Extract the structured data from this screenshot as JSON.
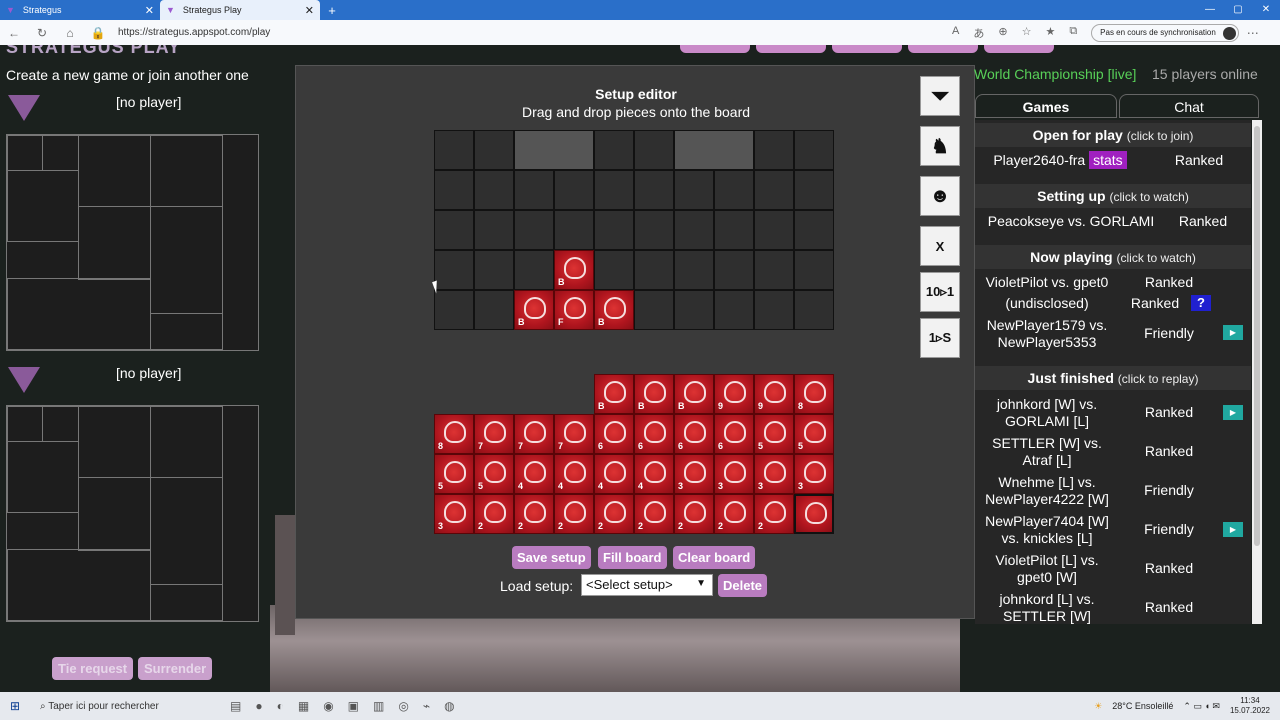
{
  "browser": {
    "tabs": [
      {
        "label": "Strategus"
      },
      {
        "label": "Strategus Play"
      }
    ],
    "url": "https://strategus.appspot.com/play",
    "sync": "Pas en cours de synchronisation"
  },
  "site": {
    "logo": "STRATEGUS PLAY",
    "subtitle": "Create a new game or join another one",
    "players": [
      {
        "label": "[no player]"
      },
      {
        "label": "[no player]"
      }
    ],
    "tie_request": "Tie request",
    "surrender": "Surrender"
  },
  "editor": {
    "title": "Setup editor",
    "subtitle": "Drag and drop pieces onto the board",
    "side_buttons": [
      "X",
      "10▹1",
      "1▹S"
    ],
    "save_setup": "Save setup",
    "fill_board": "Fill board",
    "clear_board": "Clear board",
    "load_label": "Load setup:",
    "load_value": "<Select setup>",
    "delete": "Delete",
    "board_pieces": [
      {
        "row": 3,
        "col": 3,
        "rank": "B"
      },
      {
        "row": 4,
        "col": 2,
        "rank": "B"
      },
      {
        "row": 4,
        "col": 3,
        "rank": "F"
      },
      {
        "row": 4,
        "col": 4,
        "rank": "B"
      }
    ],
    "tray": [
      [
        "",
        "",
        "",
        "",
        "B",
        "B",
        "B",
        "9",
        "9",
        "8"
      ],
      [
        "8",
        "7",
        "7",
        "7",
        "6",
        "6",
        "6",
        "6",
        "5",
        "5"
      ],
      [
        "5",
        "5",
        "4",
        "4",
        "4",
        "4",
        "3",
        "3",
        "3",
        "3"
      ],
      [
        "3",
        "2",
        "2",
        "2",
        "2",
        "2",
        "2",
        "2",
        "2",
        ""
      ]
    ]
  },
  "sidebar": {
    "championship": "World Championship [live]",
    "online": "15 players online",
    "tab_games": "Games",
    "tab_chat": "Chat",
    "open_head": "Open for play",
    "open_hint": "(click to join)",
    "open_player": "Player2640-fra",
    "stats": "stats",
    "open_type": "Ranked",
    "setup_head": "Setting up",
    "setup_hint": "(click to watch)",
    "setup_game": "Peacokseye vs. GORLAMI",
    "setup_type": "Ranked",
    "playing_head": "Now playing",
    "playing_hint": "(click to watch)",
    "playing": [
      {
        "name": "VioletPilot vs. gpet0",
        "type": "Ranked"
      },
      {
        "name": "(undisclosed)",
        "type": "Ranked"
      },
      {
        "name": "NewPlayer1579 vs. NewPlayer5353",
        "type": "Friendly"
      }
    ],
    "finished_head": "Just finished",
    "finished_hint": "(click to replay)",
    "finished": [
      {
        "name": "johnkord [W] vs. GORLAMI [L]",
        "type": "Ranked"
      },
      {
        "name": "SETTLER [W] vs. Atraf [L]",
        "type": "Ranked"
      },
      {
        "name": "Wnehme [L] vs. NewPlayer4222 [W]",
        "type": "Friendly"
      },
      {
        "name": "NewPlayer7404 [W] vs. knickles [L]",
        "type": "Friendly"
      },
      {
        "name": "VioletPilot [L] vs. gpet0 [W]",
        "type": "Ranked"
      },
      {
        "name": "johnkord [L] vs. SETTLER [W]",
        "type": "Ranked"
      }
    ]
  },
  "taskbar": {
    "search": "Taper ici pour rechercher",
    "weather": "28°C  Ensoleillé",
    "time": "11:34",
    "date": "15.07.2022"
  }
}
